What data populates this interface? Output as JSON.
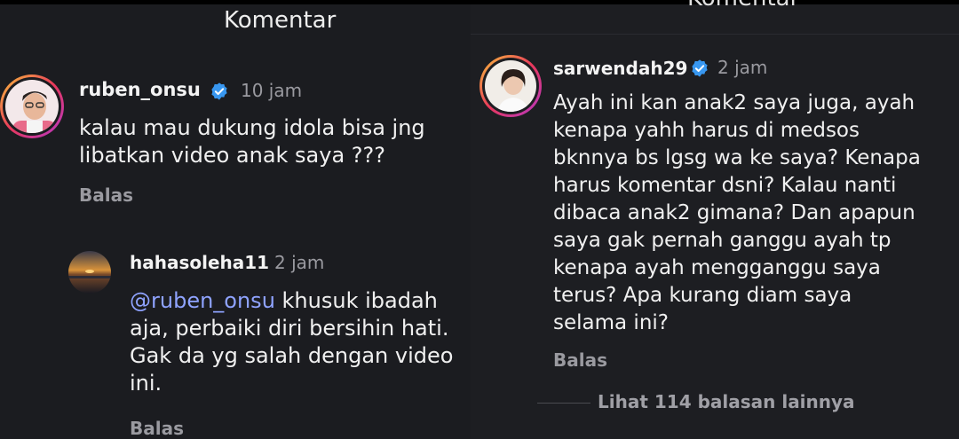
{
  "left": {
    "header_title": "Komentar",
    "comment": {
      "username": "ruben_onsu",
      "time": "10 jam",
      "text_line1": "kalau mau dukung idola bisa jng",
      "text_line2": "libatkan video anak saya ???",
      "reply_label": "Balas"
    },
    "sub_comment": {
      "username": "hahasoleha11",
      "time": "2 jam",
      "mention": "ruben_onsu",
      "text_line1_rest": " khusuk ibadah",
      "text_line2": "aja, perbaiki diri bersihin hati.",
      "text_line3": "Gak da yg salah dengan video",
      "text_line4": "ini.",
      "reply_label": "Balas"
    }
  },
  "right": {
    "header_title": "Komentar",
    "comment": {
      "username": "sarwendah29",
      "time": "2 jam",
      "lines": [
        "Ayah ini kan anak2 saya juga, ayah",
        "kenapa yahh harus di medsos",
        "bknnya bs lgsg wa ke saya? Kenapa",
        "harus komentar dsni? Kalau nanti",
        "dibaca anak2 gimana? Dan apapun",
        "saya gak pernah ganggu ayah tp",
        "kenapa ayah mengganggu saya",
        "terus? Apa kurang diam saya",
        "selama ini?"
      ],
      "reply_label": "Balas",
      "view_more": "Lihat 114 balasan lainnya"
    }
  },
  "colors": {
    "verified": "#3897f0",
    "mention": "#8fa3ff",
    "muted": "#9a9aa0"
  },
  "icons": [
    "verified-badge-icon",
    "mention-threads-icon"
  ]
}
